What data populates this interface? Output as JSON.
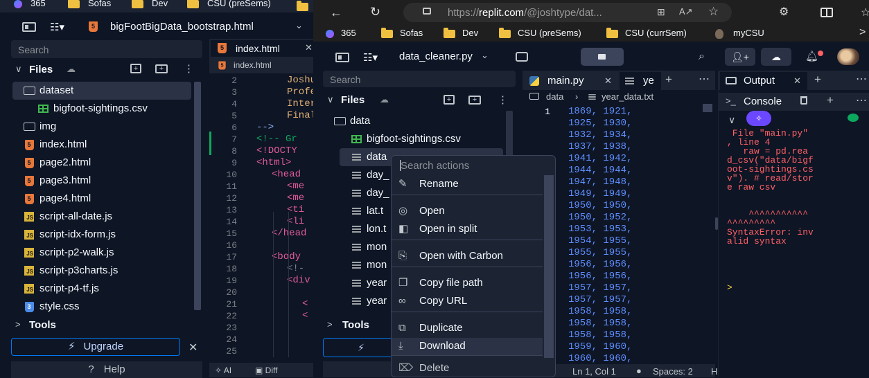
{
  "left_window": {
    "bookmarks": [
      "365",
      "Sofas",
      "Dev",
      "CSU (preSems)"
    ],
    "file_tab": "bigFootBigData_bootstrap.html",
    "search_placeholder": "Search",
    "files_label": "Files",
    "tree": [
      {
        "name": "dataset",
        "type": "folder-open"
      },
      {
        "name": "bigfoot-sightings.csv",
        "type": "csv",
        "indent": 1
      },
      {
        "name": "img",
        "type": "folder"
      },
      {
        "name": "index.html",
        "type": "html"
      },
      {
        "name": "page2.html",
        "type": "html"
      },
      {
        "name": "page3.html",
        "type": "html"
      },
      {
        "name": "page4.html",
        "type": "html"
      },
      {
        "name": "script-all-date.js",
        "type": "js"
      },
      {
        "name": "script-idx-form.js",
        "type": "js"
      },
      {
        "name": "script-p2-walk.js",
        "type": "js"
      },
      {
        "name": "script-p3charts.js",
        "type": "js"
      },
      {
        "name": "script-p4-tf.js",
        "type": "js"
      },
      {
        "name": "style.css",
        "type": "css"
      }
    ],
    "tools_label": "Tools",
    "upgrade_label": "Upgrade",
    "help_label": "Help",
    "editor_tab": "index.html",
    "editor_breadcrumb": "index.html",
    "line_numbers": [
      "2",
      "3",
      "4",
      "5",
      "6",
      "7",
      "8",
      "9",
      "10",
      "11",
      "12",
      "13",
      "14",
      "15",
      "16",
      "17",
      "18",
      "19",
      "20",
      "21",
      "22",
      "23",
      "24",
      "25"
    ],
    "code_lines": [
      "Joshu",
      "Profe",
      "Inter",
      "Final",
      "-->",
      "<!-- Gr",
      "<!DOCTY",
      "<html>",
      "<head",
      "<me",
      "<me",
      "<ti",
      "<li",
      "</head",
      "",
      "<body",
      "<!-",
      "<div",
      "",
      "<",
      "<",
      "",
      "",
      ""
    ],
    "bottom_ai": "AI",
    "bottom_diff": "Diff"
  },
  "browser": {
    "url_prefix": "https://",
    "url_domain": "replit.com",
    "url_path": "/@joshtype/dat...",
    "bookmarks": [
      "365",
      "Sofas",
      "Dev",
      "CSU (preSems)",
      "CSU (currSem)",
      "myCSU"
    ]
  },
  "replit": {
    "file_title": "data_cleaner.py",
    "search_placeholder": "Search",
    "files_label": "Files",
    "tree": [
      {
        "name": "data",
        "type": "folder-open"
      },
      {
        "name": "bigfoot-sightings.csv",
        "type": "csv"
      },
      {
        "name": "data",
        "type": "txt"
      },
      {
        "name": "day_",
        "type": "txt"
      },
      {
        "name": "day_",
        "type": "txt"
      },
      {
        "name": "lat.t",
        "type": "txt"
      },
      {
        "name": "lon.t",
        "type": "txt"
      },
      {
        "name": "mon",
        "type": "txt"
      },
      {
        "name": "mon",
        "type": "txt"
      },
      {
        "name": "year",
        "type": "txt"
      },
      {
        "name": "year",
        "type": "txt"
      }
    ],
    "tools_label": "Tools",
    "editor_tabs": [
      "main.py",
      "ye"
    ],
    "breadcrumb": [
      "data",
      "year_data.txt"
    ],
    "editor_lines": [
      "1869, 1921,",
      "1925, 1930,",
      "1932, 1934,",
      "1937, 1938,",
      "1941, 1942,",
      "1944, 1944,",
      "1947, 1948,",
      "1949, 1949,",
      "1950, 1950,",
      "1950, 1952,",
      "1953, 1953,",
      "1954, 1955,",
      "1955, 1955,",
      "1956, 1956,",
      "1956, 1956,",
      "1957, 1957,",
      "1957, 1957,",
      "1958, 1958,",
      "1958, 1958,",
      "1958, 1958,",
      "1959, 1960,",
      "1960, 1960,"
    ],
    "status": {
      "position": "Ln 1, Col 1",
      "spaces": "Spaces: 2"
    },
    "output_tab": "Output",
    "console_tab": "Console",
    "console_error": [
      " File \"main.py\"",
      ", line 4",
      "   raw = pd.rea",
      "d_csv(\"data/bigf",
      "oot-sightings.cs",
      "v\"). # read/stor",
      "e raw csv",
      "",
      "",
      "    ^^^^^^^^^^^",
      "^^^^^^^^^",
      "SyntaxError: inv",
      "alid syntax"
    ],
    "console_prompt": ">"
  },
  "context_menu": {
    "search_placeholder": "Search actions",
    "items": [
      {
        "label": "Rename",
        "icon": "pencil-icon"
      },
      {
        "label": "Open",
        "icon": "eye-icon"
      },
      {
        "label": "Open in split",
        "icon": "split-icon"
      },
      {
        "label": "Open with Carbon",
        "icon": "carbon-icon"
      },
      {
        "label": "Copy file path",
        "icon": "copy-icon"
      },
      {
        "label": "Copy URL",
        "icon": "link-icon"
      },
      {
        "label": "Duplicate",
        "icon": "duplicate-icon"
      },
      {
        "label": "Download",
        "icon": "download-icon"
      },
      {
        "label": "Delete",
        "icon": "trash-icon"
      }
    ]
  },
  "colors": {
    "background": "#0e1525",
    "panel": "#1c2333",
    "error": "#ff6166",
    "number": "#5e8fff",
    "accent": "#0079f2"
  }
}
